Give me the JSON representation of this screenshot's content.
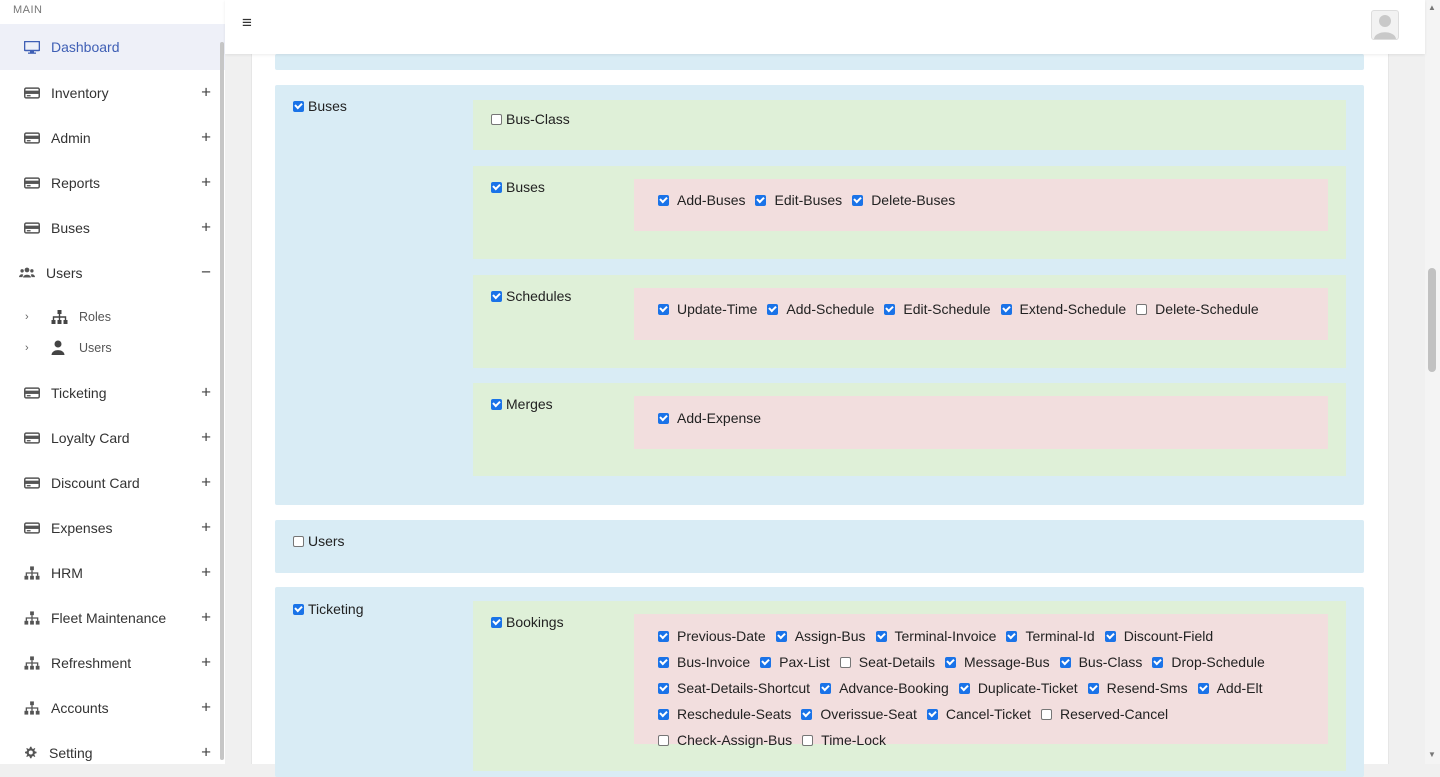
{
  "sidebar": {
    "section": "MAIN",
    "items": [
      {
        "label": "Dashboard",
        "icon": "monitor-icon",
        "active": true
      },
      {
        "label": "Inventory",
        "icon": "card-icon",
        "toggle": "+"
      },
      {
        "label": "Admin",
        "icon": "card-icon",
        "toggle": "+"
      },
      {
        "label": "Reports",
        "icon": "card-icon",
        "toggle": "+"
      },
      {
        "label": "Buses",
        "icon": "card-icon",
        "toggle": "+"
      },
      {
        "label": "Users",
        "icon": "users-icon",
        "toggle": "−",
        "expanded": true,
        "children": [
          {
            "label": "Roles",
            "icon": "sitemap-icon"
          },
          {
            "label": "Users",
            "icon": "user-icon"
          }
        ]
      },
      {
        "label": "Ticketing",
        "icon": "card-icon",
        "toggle": "+"
      },
      {
        "label": "Loyalty Card",
        "icon": "card-icon",
        "toggle": "+"
      },
      {
        "label": "Discount Card",
        "icon": "card-icon",
        "toggle": "+"
      },
      {
        "label": "Expenses",
        "icon": "card-icon",
        "toggle": "+"
      },
      {
        "label": "HRM",
        "icon": "sitemap-icon",
        "toggle": "+"
      },
      {
        "label": "Fleet Maintenance",
        "icon": "sitemap-icon",
        "toggle": "+"
      },
      {
        "label": "Refreshment",
        "icon": "sitemap-icon",
        "toggle": "+"
      },
      {
        "label": "Accounts",
        "icon": "sitemap-icon",
        "toggle": "+"
      },
      {
        "label": "Setting",
        "icon": "gear-icon",
        "toggle": "+"
      }
    ]
  },
  "topbar": {
    "menu_glyph": "≡"
  },
  "permissions": {
    "buses": {
      "label": "Buses",
      "checked": true,
      "busclass": {
        "label": "Bus-Class",
        "checked": false
      },
      "buses_sub": {
        "label": "Buses",
        "checked": true,
        "actions": [
          {
            "label": "Add-Buses",
            "checked": true
          },
          {
            "label": "Edit-Buses",
            "checked": true
          },
          {
            "label": "Delete-Buses",
            "checked": true
          }
        ]
      },
      "schedules": {
        "label": "Schedules",
        "checked": true,
        "actions": [
          {
            "label": "Update-Time",
            "checked": true
          },
          {
            "label": "Add-Schedule",
            "checked": true
          },
          {
            "label": "Edit-Schedule",
            "checked": true
          },
          {
            "label": "Extend-Schedule",
            "checked": true
          },
          {
            "label": "Delete-Schedule",
            "checked": false
          }
        ]
      },
      "merges": {
        "label": "Merges",
        "checked": true,
        "actions": [
          {
            "label": "Add-Expense",
            "checked": true
          }
        ]
      }
    },
    "users": {
      "label": "Users",
      "checked": false
    },
    "ticketing": {
      "label": "Ticketing",
      "checked": true,
      "bookings": {
        "label": "Bookings",
        "checked": true,
        "actions": [
          {
            "label": "Previous-Date",
            "checked": true
          },
          {
            "label": "Assign-Bus",
            "checked": true
          },
          {
            "label": "Terminal-Invoice",
            "checked": true
          },
          {
            "label": "Terminal-Id",
            "checked": true
          },
          {
            "label": "Discount-Field",
            "checked": true
          },
          {
            "label": "Bus-Invoice",
            "checked": true
          },
          {
            "label": "Pax-List",
            "checked": true
          },
          {
            "label": "Seat-Details",
            "checked": false
          },
          {
            "label": "Message-Bus",
            "checked": true
          },
          {
            "label": "Bus-Class",
            "checked": true
          },
          {
            "label": "Drop-Schedule",
            "checked": true
          },
          {
            "label": "Seat-Details-Shortcut",
            "checked": true
          },
          {
            "label": "Advance-Booking",
            "checked": true
          },
          {
            "label": "Duplicate-Ticket",
            "checked": true
          },
          {
            "label": "Resend-Sms",
            "checked": true
          },
          {
            "label": "Add-Elt",
            "checked": true
          },
          {
            "label": "Reschedule-Seats",
            "checked": true
          },
          {
            "label": "Overissue-Seat",
            "checked": true
          },
          {
            "label": "Cancel-Ticket",
            "checked": true
          },
          {
            "label": "Reserved-Cancel",
            "checked": false
          },
          {
            "label": "Check-Assign-Bus",
            "checked": false
          },
          {
            "label": "Time-Lock",
            "checked": null
          }
        ]
      }
    }
  }
}
